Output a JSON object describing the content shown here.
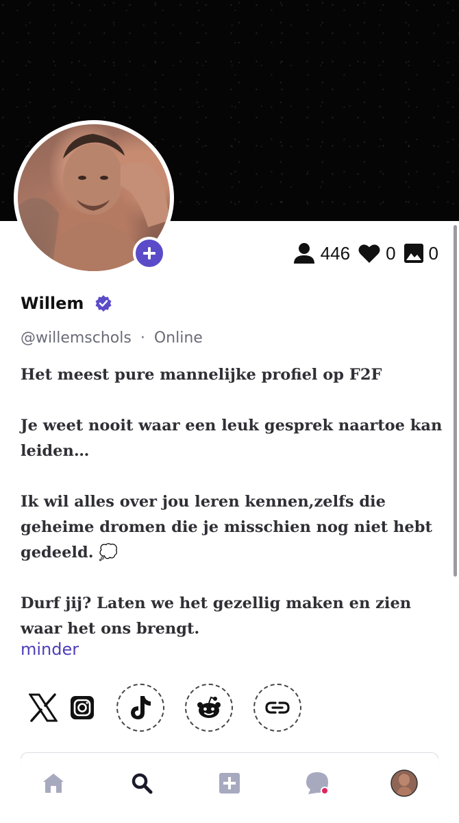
{
  "profile": {
    "name": "Willem",
    "handle": "@willemschols",
    "separator": "·",
    "status": "Online",
    "verified": true,
    "avatar_icon": "profile-photo"
  },
  "stats": {
    "followers": "446",
    "likes": "0",
    "media": "0"
  },
  "bio": {
    "paragraphs": [
      "Het meest pure mannelijke profiel op F2F",
      "Je weet nooit waar een leuk gesprek naartoe kan leiden…",
      "Ik wil alles over jou leren kennen,zelfs die geheime dromen die je misschien nog niet hebt gedeeld. 💭",
      "Durf jij? Laten we het gezellig maken en zien waar het ons brengt."
    ],
    "toggle_label": "minder"
  },
  "socials": [
    "x-icon",
    "instagram-icon",
    "tiktok-icon",
    "reddit-icon",
    "link-icon"
  ],
  "nav": [
    "home-icon",
    "search-icon",
    "create-icon",
    "messages-icon",
    "profile-avatar"
  ],
  "colors": {
    "accent": "#5a4bc8",
    "link": "#4d3fb8",
    "banner": "#050506",
    "notification_dot": "#e0245e"
  }
}
